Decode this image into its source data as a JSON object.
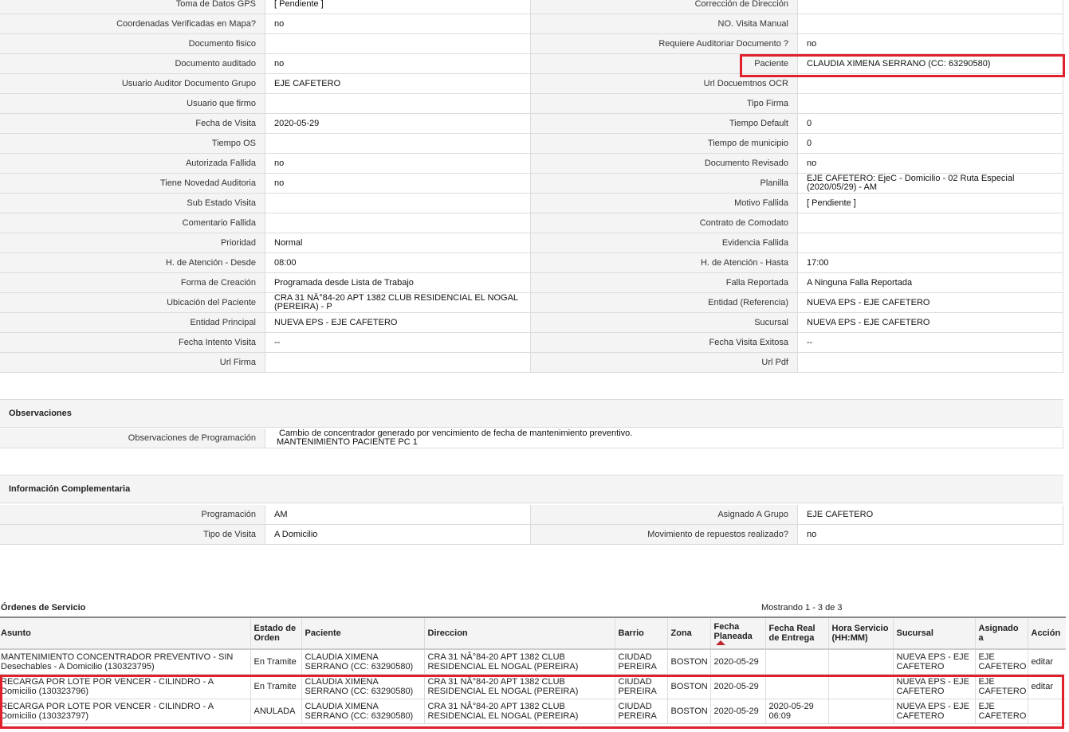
{
  "details": [
    [
      "Toma de Datos GPS",
      "[ Pendiente ]",
      "Corrección de Dirección",
      ""
    ],
    [
      "Coordenadas Verificadas en Mapa?",
      "no",
      "NO. Visita Manual",
      ""
    ],
    [
      "Documento fisico",
      "",
      "Requiere Auditoriar Documento ?",
      "no"
    ],
    [
      "Documento auditado",
      "no",
      "Paciente",
      "CLAUDIA XIMENA SERRANO (CC: 63290580)"
    ],
    [
      "Usuario Auditor Documento Grupo",
      "EJE CAFETERO",
      "Url Docuemtnos OCR",
      ""
    ],
    [
      "Usuario que firmo",
      "",
      "Tipo Firma",
      ""
    ],
    [
      "Fecha de Visita",
      "2020-05-29",
      "Tiempo Default",
      "0"
    ],
    [
      "Tiempo OS",
      "",
      "Tiempo de municipio",
      "0"
    ],
    [
      "Autorizada Fallida",
      "no",
      "Documento Revisado",
      "no"
    ],
    [
      "Tiene Novedad Auditoria",
      "no",
      "Planilla",
      "EJE CAFETERO: EjeC - Domicilio - 02 Ruta Especial (2020/05/29) - AM"
    ],
    [
      "Sub Estado Visita",
      "",
      "Motivo Fallida",
      "[ Pendiente ]"
    ],
    [
      "Comentario Fallida",
      "",
      "Contrato de Comodato",
      ""
    ],
    [
      "Prioridad",
      "Normal",
      "Evidencia Fallida",
      ""
    ],
    [
      "H. de Atención - Desde",
      "08:00",
      "H. de Atención - Hasta",
      "17:00"
    ],
    [
      "Forma de Creación",
      "Programada desde Lista de Trabajo",
      "Falla Reportada",
      "A Ninguna Falla Reportada"
    ],
    [
      "Ubicación del Paciente",
      "CRA 31 NÂ°84-20 APT 1382 CLUB RESIDENCIAL EL NOGAL (PEREIRA) - P",
      "Entidad (Referencia)",
      "NUEVA EPS - EJE CAFETERO"
    ],
    [
      "Entidad Principal",
      "NUEVA EPS - EJE CAFETERO",
      "Sucursal",
      "NUEVA EPS - EJE CAFETERO"
    ],
    [
      "Fecha Intento Visita",
      "--",
      "Fecha Visita Exitosa",
      "--"
    ],
    [
      "Url Firma",
      "",
      "Url Pdf",
      ""
    ]
  ],
  "observaciones": {
    "title": "Observaciones",
    "label": "Observaciones de Programación",
    "line1": "Cambio de concentrador generado por vencimiento de fecha de mantenimiento preventivo.",
    "line2": "MANTENIMIENTO PACIENTE PC 1"
  },
  "complementaria": {
    "title": "Información Complementaria",
    "rows": [
      [
        "Programación",
        "AM",
        "Asignado A Grupo",
        "EJE CAFETERO"
      ],
      [
        "Tipo de Visita",
        "A Domicilio",
        "Movimiento de repuestos realizado?",
        "no"
      ]
    ]
  },
  "orders": {
    "title": "Órdenes de Servicio",
    "count": "Mostrando 1 - 3 de 3",
    "columns": [
      "Asunto",
      "Estado de Orden",
      "Paciente",
      "Direccion",
      "Barrio",
      "Zona",
      "Fecha Planeada",
      "Fecha Real de Entrega",
      "Hora Servicio (HH:MM)",
      "Sucursal",
      "Asignado a",
      "Acción"
    ],
    "rows": [
      [
        "MANTENIMIENTO CONCENTRADOR PREVENTIVO - SIN Desechables - A Domicilio (130323795)",
        "En Tramite",
        "CLAUDIA XIMENA SERRANO (CC: 63290580)",
        "CRA 31 NÂ°84-20 APT 1382 CLUB RESIDENCIAL EL NOGAL (PEREIRA)",
        "CIUDAD PEREIRA",
        "BOSTON",
        "2020-05-29",
        "",
        "",
        "NUEVA EPS - EJE CAFETERO",
        "EJE CAFETERO",
        "editar"
      ],
      [
        "RECARGA POR LOTE POR VENCER - CILINDRO - A Domicilio (130323796)",
        "En Tramite",
        "CLAUDIA XIMENA SERRANO (CC: 63290580)",
        "CRA 31 NÂ°84-20 APT 1382 CLUB RESIDENCIAL EL NOGAL (PEREIRA)",
        "CIUDAD PEREIRA",
        "BOSTON",
        "2020-05-29",
        "",
        "",
        "NUEVA EPS - EJE CAFETERO",
        "EJE CAFETERO",
        "editar"
      ],
      [
        "RECARGA POR LOTE POR VENCER - CILINDRO - A Domicilio (130323797)",
        "ANULADA",
        "CLAUDIA XIMENA SERRANO (CC: 63290580)",
        "CRA 31 NÂ°84-20 APT 1382 CLUB RESIDENCIAL EL NOGAL (PEREIRA)",
        "CIUDAD PEREIRA",
        "BOSTON",
        "2020-05-29",
        "2020-05-29 06:09",
        "",
        "NUEVA EPS - EJE CAFETERO",
        "EJE CAFETERO",
        ""
      ]
    ]
  },
  "highlight_color": "#e0202a",
  "sort_indicator_color": "#c0272d"
}
